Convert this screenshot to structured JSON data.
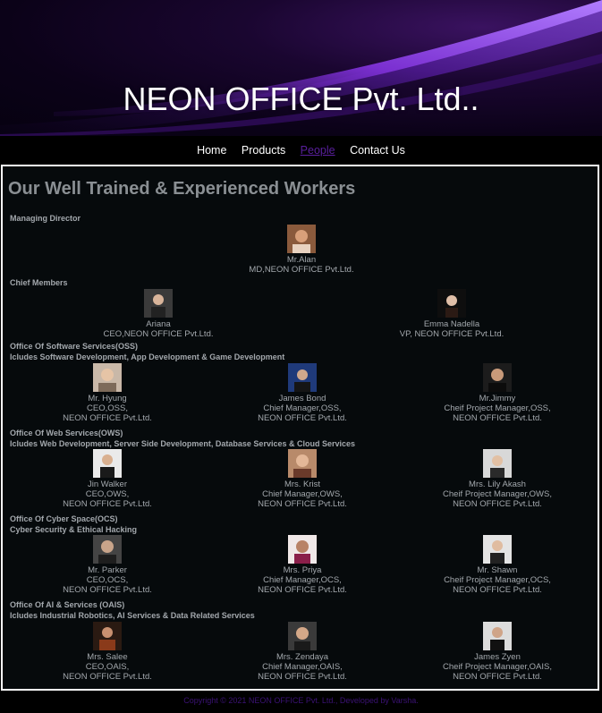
{
  "site_title": "NEON OFFICE Pvt. Ltd..",
  "nav": {
    "home": "Home",
    "products": "Products",
    "people": "People",
    "contact": "Contact Us"
  },
  "page_heading": "Our Well Trained & Experienced Workers",
  "sections": {
    "md": {
      "title": "Managing Director",
      "people": [
        {
          "name": "Mr.Alan",
          "role1": "MD,NEON OFFICE Pvt.Ltd.",
          "role2": ""
        }
      ]
    },
    "chief": {
      "title": "Chief Members",
      "people": [
        {
          "name": "Ariana",
          "role1": "CEO,NEON OFFICE Pvt.Ltd.",
          "role2": ""
        },
        {
          "name": "Emma Nadella",
          "role1": "VP, NEON OFFICE Pvt.Ltd.",
          "role2": ""
        }
      ]
    },
    "oss": {
      "title": "Office Of Software Services(OSS)",
      "subtitle": "Icludes Software Development, App Development & Game Development",
      "people": [
        {
          "name": "Mr. Hyung",
          "role1": "CEO,OSS,",
          "role2": "NEON OFFICE Pvt.Ltd."
        },
        {
          "name": "James Bond",
          "role1": "Chief Manager,OSS,",
          "role2": "NEON OFFICE Pvt.Ltd."
        },
        {
          "name": "Mr.Jimmy",
          "role1": "Cheif Project Manager,OSS,",
          "role2": "NEON OFFICE Pvt.Ltd."
        }
      ]
    },
    "ows": {
      "title": "Office Of Web Services(OWS)",
      "subtitle": "Icludes Web Development, Server Side Development, Database Services & Cloud Services",
      "people": [
        {
          "name": "Jin Walker",
          "role1": "CEO,OWS,",
          "role2": "NEON OFFICE Pvt.Ltd."
        },
        {
          "name": "Mrs. Krist",
          "role1": "Chief Manager,OWS,",
          "role2": "NEON OFFICE Pvt.Ltd."
        },
        {
          "name": "Mrs. Lily Akash",
          "role1": "Cheif Project Manager,OWS,",
          "role2": "NEON OFFICE Pvt.Ltd."
        }
      ]
    },
    "ocs": {
      "title": "Office Of Cyber Space(OCS)",
      "subtitle": "Cyber Security & Ethical Hacking",
      "people": [
        {
          "name": "Mr. Parker",
          "role1": "CEO,OCS,",
          "role2": "NEON OFFICE Pvt.Ltd."
        },
        {
          "name": "Mrs. Priya",
          "role1": "Chief Manager,OCS,",
          "role2": "NEON OFFICE Pvt.Ltd."
        },
        {
          "name": "Mr. Shawn",
          "role1": "Cheif Project Manager,OCS,",
          "role2": "NEON OFFICE Pvt.Ltd."
        }
      ]
    },
    "oais": {
      "title": "Office Of AI & Services (OAIS)",
      "subtitle": "Icludes Industrial Robotics, AI Services & Data Related Services",
      "people": [
        {
          "name": "Mrs. Salee",
          "role1": "CEO,OAIS,",
          "role2": "NEON OFFICE Pvt.Ltd."
        },
        {
          "name": "Mrs. Zendaya",
          "role1": "Chief Manager,OAIS,",
          "role2": "NEON OFFICE Pvt.Ltd."
        },
        {
          "name": "James Zyen",
          "role1": "Cheif Project Manager,OAIS,",
          "role2": "NEON OFFICE Pvt.Ltd."
        }
      ]
    }
  },
  "footer": "Copyright © 2021 NEON OFFICE Pvt. Ltd., Developed by Varsha.",
  "colors": {
    "active_link": "#5a1f9e",
    "footer_text": "#3b1275",
    "banner_swoosh": "#8b3ce0"
  }
}
